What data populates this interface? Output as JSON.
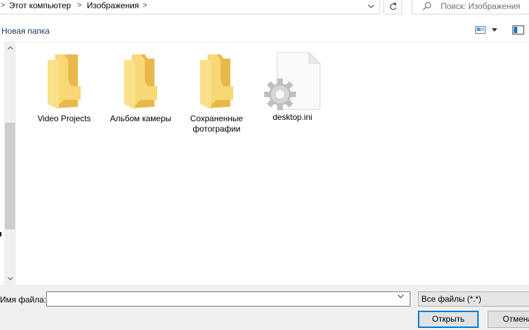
{
  "address_bar": {
    "breadcrumbs": [
      "Этот компьютер",
      "Изображения"
    ],
    "separator": "›"
  },
  "search": {
    "placeholder": "Поиск: Изображения"
  },
  "toolbar": {
    "new_folder_label": "Новая папка"
  },
  "files": [
    {
      "name": "Video Projects",
      "type": "folder"
    },
    {
      "name": "Альбом камеры",
      "type": "folder"
    },
    {
      "name": "Сохраненные фотографии",
      "type": "folder"
    },
    {
      "name": "desktop.ini",
      "type": "settings-file"
    }
  ],
  "footer": {
    "filename_label": "Имя файла:",
    "filename_value": "",
    "filter_value": "Все файлы (*.*)",
    "open_label": "Открыть",
    "cancel_label": "Отмена"
  },
  "colors": {
    "folder_body": "#f8d775",
    "folder_back": "#e8b94a",
    "selection": "#cce8ff",
    "accent": "#0078d7"
  }
}
